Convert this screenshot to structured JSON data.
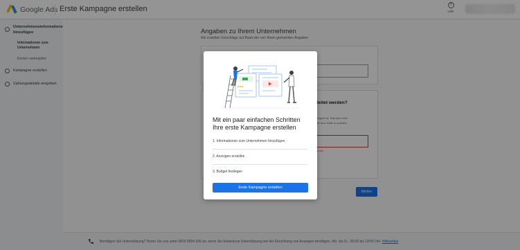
{
  "topbar": {
    "brand": "Google Ads",
    "page_title": "Erste Kampagne erstellen",
    "help_label": "Hilfe",
    "help_icon": "help-circle-icon"
  },
  "sidebar": {
    "steps": [
      {
        "label": "Unternehmensinformationen hinzufügen"
      },
      {
        "label": "Kampagne erstellen"
      },
      {
        "label": "Zahlungsdetails eingeben"
      }
    ],
    "substeps": [
      {
        "label": "Informationen zum Unternehmen"
      },
      {
        "label": "Konten verknüpfen"
      }
    ]
  },
  "main": {
    "title": "Angaben zu Ihrem Unternehmen",
    "subtitle": "Wir erstellen Vorschläge auf Basis der von Ihnen gemachten Angaben",
    "card2_heading": "gleitet werden?",
    "card2_text_1": "geeignet ist. Das kann eine",
    "card2_text_2": "oder eine Seite in sozialen",
    "error_text": "llen ein.",
    "next_button": "Weiter"
  },
  "footer": {
    "text": "Benötigen Sie Unterstützung? Rufen Sie uns unter 0800 5894 306 an, wenn Sie kostenlose Unterstützung bei der Einrichtung von Anzeigen benötigen. Mo. bis Fr., 09:00 bis 18:00 Uhr.",
    "link": "Hilfeartikel",
    "phone_icon": "phone-icon"
  },
  "modal": {
    "title": "Mit ein paar einfachen Schritten Ihre erste Kampagne erstellen",
    "items": [
      "1. Informationen zum Unternehmen hinzufügen",
      "2. Anzeigen erstellen",
      "3. Budget festlegen"
    ],
    "button": "Erste Kampagne erstellen"
  },
  "colors": {
    "accent": "#1a73e8",
    "error": "#d93025"
  }
}
